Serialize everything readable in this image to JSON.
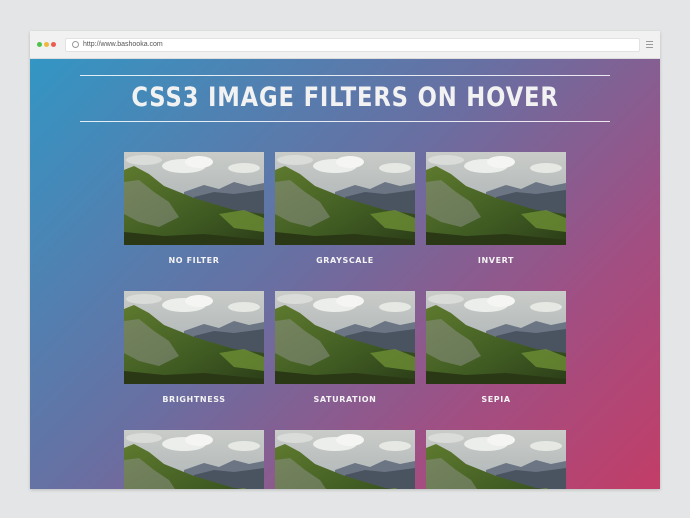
{
  "browser": {
    "url": "http://www.bashooka.com",
    "controls": [
      "close",
      "minimize",
      "maximize"
    ],
    "menu_icon": "hamburger-menu-icon"
  },
  "page": {
    "title": "CSS3 IMAGE FILTERS ON HOVER",
    "gradient": [
      "#3396c4",
      "#6a6ea1",
      "#a24e82",
      "#c23d67"
    ]
  },
  "gallery": {
    "items": [
      {
        "label": "NO FILTER",
        "filter": "none"
      },
      {
        "label": "GRAYSCALE",
        "filter": "none"
      },
      {
        "label": "INVERT",
        "filter": "none"
      },
      {
        "label": "BRIGHTNESS",
        "filter": "none"
      },
      {
        "label": "SATURATION",
        "filter": "none"
      },
      {
        "label": "SEPIA",
        "filter": "none"
      },
      {
        "label": "",
        "filter": "none"
      },
      {
        "label": "",
        "filter": "none"
      },
      {
        "label": "",
        "filter": "none"
      }
    ]
  }
}
